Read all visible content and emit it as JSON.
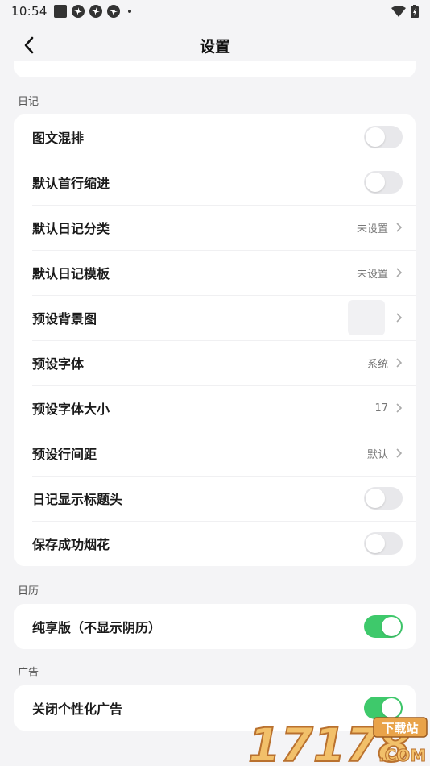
{
  "status_bar": {
    "time": "10:54"
  },
  "header": {
    "title": "设置"
  },
  "sections": [
    {
      "label": "日记",
      "rows": [
        {
          "label": "图文混排",
          "type": "toggle",
          "on": false
        },
        {
          "label": "默认首行缩进",
          "type": "toggle",
          "on": false
        },
        {
          "label": "默认日记分类",
          "type": "value",
          "value": "未设置"
        },
        {
          "label": "默认日记模板",
          "type": "value",
          "value": "未设置"
        },
        {
          "label": "预设背景图",
          "type": "image"
        },
        {
          "label": "预设字体",
          "type": "value",
          "value": "系统"
        },
        {
          "label": "预设字体大小",
          "type": "value",
          "value": "17"
        },
        {
          "label": "预设行间距",
          "type": "value",
          "value": "默认"
        },
        {
          "label": "日记显示标题头",
          "type": "toggle",
          "on": false
        },
        {
          "label": "保存成功烟花",
          "type": "toggle",
          "on": false
        }
      ]
    },
    {
      "label": "日历",
      "rows": [
        {
          "label": "纯享版（不显示阴历）",
          "type": "toggle",
          "on": true
        }
      ]
    },
    {
      "label": "广告",
      "rows": [
        {
          "label": "关闭个性化广告",
          "type": "toggle",
          "on": true
        }
      ]
    }
  ],
  "watermark": {
    "text": "17178",
    "badge": "下载站",
    "domain": ".COM"
  },
  "colors": {
    "toggle_on": "#3ec96b",
    "toggle_off": "#e8e8eb",
    "background": "#f4f4f6"
  }
}
